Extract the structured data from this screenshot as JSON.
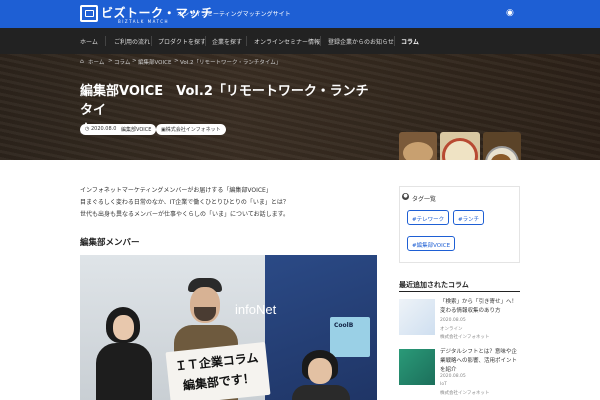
{
  "header": {
    "logo_text": "ビズトーク・マッチ",
    "logo_sub": "BIZTALK MATCH",
    "tagline": "オンラインミーティングマッチングサイト",
    "rss_icon": "rss-icon"
  },
  "nav": {
    "items": [
      {
        "label": "ホーム",
        "active": false
      },
      {
        "label": "ご利用の流れ",
        "active": false
      },
      {
        "label": "プロダクトを探す",
        "active": false
      },
      {
        "label": "企業を探す",
        "active": false
      },
      {
        "label": "オンラインセミナー情報",
        "active": false
      },
      {
        "label": "登録企業からのお知らせ",
        "active": false
      },
      {
        "label": "コラム",
        "active": true
      }
    ]
  },
  "breadcrumb": {
    "home_icon": "home-icon",
    "items": [
      "ホーム",
      "コラム",
      "編集部VOICE",
      "Vol.2「リモートワーク・ランチタイム」"
    ],
    "separator": ">"
  },
  "article": {
    "title_line1": "編集部VOICE　Vol.2「リモートワーク・ランチタイ",
    "title_line2": "ム」",
    "date": "2020.08.04",
    "category": "編集部VOICE",
    "author": "株式会社インフォネット",
    "intro_lines": [
      "インフォネットマーケティングメンバーがお届けする「編集部VOICE」",
      "目まぐるしく変わる日常のなか、IT企業で働くひとりひとりの「いま」とは？",
      "世代も出身も異なるメンバーが仕事やくらしの「いま」についてお話します。"
    ],
    "section_heading": "編集部メンバー",
    "photo": {
      "wall_logo": "infoNet",
      "sign_line1": "ＩＴ企業コラム",
      "sign_line2": "編集部です！",
      "banner_text": "CoolB"
    }
  },
  "sidebar": {
    "tags_title": "タグ一覧",
    "tags": [
      "#テレワーク",
      "#ランチ",
      "#編集部VOICE"
    ],
    "recent_title": "最近追加されたコラム",
    "recent": [
      {
        "title": "「検索」から「引き寄せ」へ！変わる情報収集のあり方",
        "date": "2020.08.05",
        "category": "オンライン",
        "author": "株式会社インフォネット"
      },
      {
        "title": "デジタルシフトとは？意味や企業戦略への影響、活用ポイントを紹介",
        "date": "2020.08.05",
        "category": "IoT",
        "author": "株式会社インフォネット"
      }
    ]
  },
  "colors": {
    "brand_blue": "#1e5fd4",
    "nav_bg": "#222222",
    "hero_bg": "#2d241c"
  }
}
